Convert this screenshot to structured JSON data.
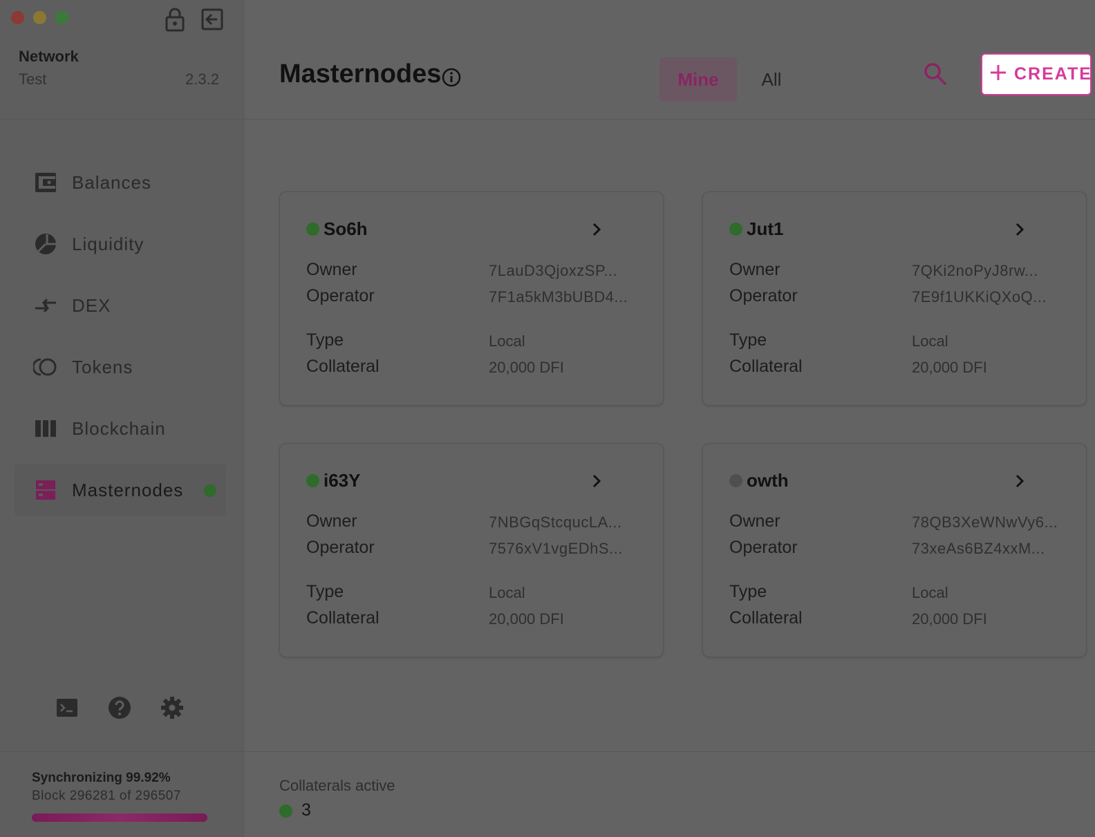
{
  "sidebar": {
    "network_label": "Network",
    "network_value": "Test",
    "version": "2.3.2",
    "items": [
      {
        "label": "Balances",
        "icon": "wallet-icon"
      },
      {
        "label": "Liquidity",
        "icon": "pie-chart-icon"
      },
      {
        "label": "DEX",
        "icon": "swap-arrows-icon"
      },
      {
        "label": "Tokens",
        "icon": "tokens-icon"
      },
      {
        "label": "Blockchain",
        "icon": "blocks-icon"
      },
      {
        "label": "Masternodes",
        "icon": "server-icon",
        "active": true
      }
    ],
    "sync": {
      "title": "Synchronizing 99.92%",
      "block": "Block 296281 of 296507",
      "progress_percent": 99.92
    }
  },
  "header": {
    "title": "Masternodes",
    "tabs": [
      {
        "label": "Mine",
        "active": true
      },
      {
        "label": "All",
        "active": false
      }
    ],
    "create_label": "CREATE"
  },
  "labels": {
    "owner": "Owner",
    "operator": "Operator",
    "type": "Type",
    "collateral": "Collateral"
  },
  "cards": [
    {
      "name": "So6h",
      "status": "active",
      "owner": "7LauD3QjoxzSP...",
      "operator": "7F1a5kM3bUBD4...",
      "type": "Local",
      "collateral": "20,000 DFI"
    },
    {
      "name": "Jut1",
      "status": "active",
      "owner": "7QKi2noPyJ8rw...",
      "operator": "7E9f1UKKiQXoQ...",
      "type": "Local",
      "collateral": "20,000 DFI"
    },
    {
      "name": "i63Y",
      "status": "active",
      "owner": "7NBGqStcqucLA...",
      "operator": "7576xV1vgEDhS...",
      "type": "Local",
      "collateral": "20,000 DFI"
    },
    {
      "name": "owth",
      "status": "inactive",
      "owner": "78QB3XeWNwVy6...",
      "operator": "73xeAs6BZ4xxM...",
      "type": "Local",
      "collateral": "20,000 DFI"
    }
  ],
  "footer": {
    "collaterals_label": "Collaterals active",
    "collaterals_value": "3"
  },
  "colors": {
    "accent": "#d63a9a",
    "active_status": "#2f6b2a",
    "inactive_status": "#4f4f4f"
  }
}
